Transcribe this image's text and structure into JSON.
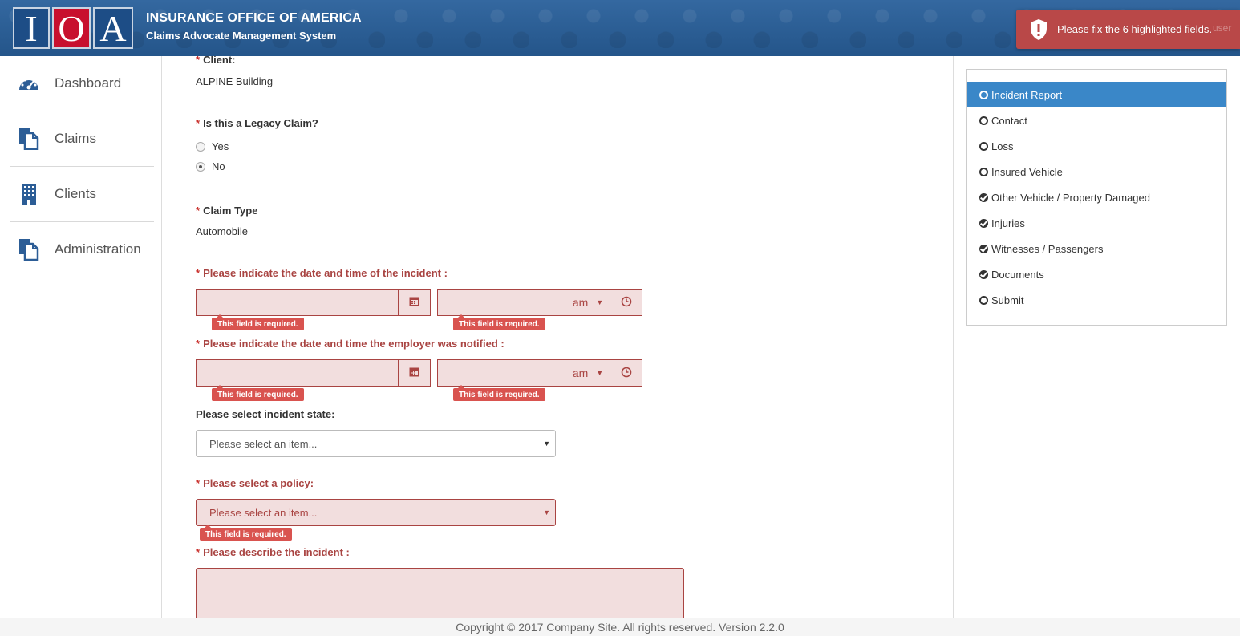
{
  "header": {
    "logo_letters": [
      "I",
      "O",
      "A"
    ],
    "title": "INSURANCE OFFICE OF AMERICA",
    "subtitle": "Claims Advocate Management System",
    "toast_message": "Please fix the 6 highlighted fields.",
    "toast_ghost_text": "user",
    "colors": {
      "header_bg": "#2b5f95",
      "toast_bg": "#b94848",
      "logo_red": "#c8102e"
    }
  },
  "sidebar": {
    "items": [
      {
        "label": "Dashboard",
        "icon": "dashboard-gauge-icon"
      },
      {
        "label": "Claims",
        "icon": "documents-icon"
      },
      {
        "label": "Clients",
        "icon": "building-icon"
      },
      {
        "label": "Administration",
        "icon": "documents-icon"
      }
    ]
  },
  "form": {
    "required_mark": "*",
    "client_label": "Client:",
    "client_value": "ALPINE Building",
    "legacy_label": "Is this a Legacy Claim?",
    "legacy_options": [
      {
        "label": "Yes",
        "selected": false
      },
      {
        "label": "No",
        "selected": true
      }
    ],
    "claim_type_label": "Claim Type",
    "claim_type_value": "Automobile",
    "incident_datetime_label": "Please indicate the date and time of the incident :",
    "employer_notified_label": "Please indicate the date and time the employer was notified :",
    "ampm_value": "am",
    "required_error": "This field is required.",
    "state_label": "Please select incident state:",
    "state_placeholder": "Please select an item...",
    "policy_label": "Please select a policy:",
    "policy_placeholder": "Please select an item...",
    "describe_label": "Please describe the incident :",
    "colors": {
      "error_text": "#a94442",
      "error_bg": "#f2dede",
      "tip_bg": "#d9534f"
    }
  },
  "steps": {
    "items": [
      {
        "label": "Incident Report",
        "status": "open",
        "active": true
      },
      {
        "label": "Contact",
        "status": "open",
        "active": false
      },
      {
        "label": "Loss",
        "status": "open",
        "active": false
      },
      {
        "label": "Insured Vehicle",
        "status": "open",
        "active": false
      },
      {
        "label": "Other Vehicle / Property Damaged",
        "status": "done",
        "active": false
      },
      {
        "label": "Injuries",
        "status": "done",
        "active": false
      },
      {
        "label": "Witnesses / Passengers",
        "status": "done",
        "active": false
      },
      {
        "label": "Documents",
        "status": "done",
        "active": false
      },
      {
        "label": "Submit",
        "status": "open",
        "active": false
      }
    ],
    "colors": {
      "active_bg": "#3a87c8"
    }
  },
  "footer": {
    "text": "Copyright © 2017 Company Site. All rights reserved. Version 2.2.0"
  }
}
